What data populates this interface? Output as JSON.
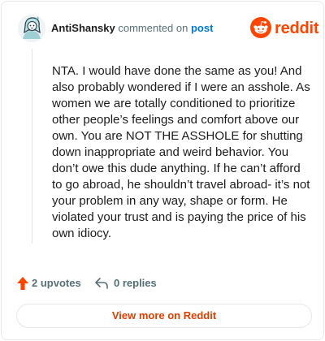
{
  "comment": {
    "username": "AntiShansky",
    "verb": " commented on ",
    "post_link": "post",
    "body": "NTA. I would have done the same as you! And also probably wondered if I were an asshole. As women we are totally conditioned to prioritize other people’s feelings and comfort above our own. You are NOT THE ASSHOLE for shutting down inappropriate and weird behavior. You don’t owe this dude anything. If he can’t afford to go abroad, he shouldn’t travel abroad- it’s not your problem in any way, shape or form. He violated your trust and is paying the price of his own idiocy."
  },
  "brand": {
    "name": "reddit",
    "icon": "reddit-snoo-icon",
    "color": "#ff4500"
  },
  "actions": {
    "upvotes": "2 upvotes",
    "upvote_icon": "upvote-arrow-icon",
    "upvote_color": "#ff4500",
    "replies": "0 replies",
    "reply_icon": "reply-arrow-icon"
  },
  "footer": {
    "view_more": "View more on Reddit",
    "color": "#e03d00"
  }
}
